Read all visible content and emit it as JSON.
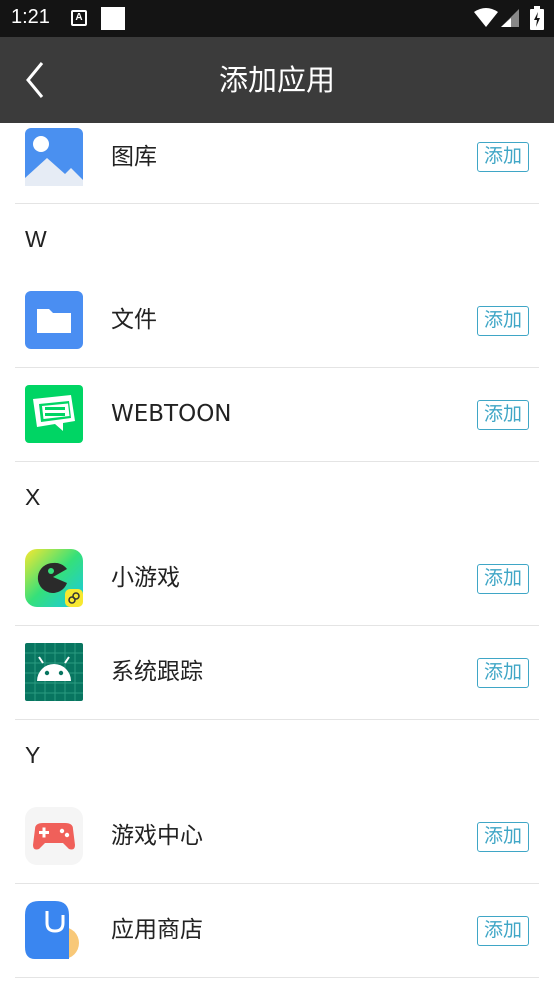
{
  "status_bar": {
    "time": "1:21",
    "notif_icon_letter": "A"
  },
  "header": {
    "title": "添加应用",
    "back_icon": "chevron-left-icon"
  },
  "colors": {
    "app_bar": "#3b3b3b",
    "status_bar": "#141414",
    "accent": "#3fa6c6"
  },
  "add_label": "添加",
  "sections": [
    {
      "letter": "",
      "apps": [
        {
          "name": "图库",
          "icon": "gallery-icon"
        }
      ]
    },
    {
      "letter": "W",
      "apps": [
        {
          "name": "文件",
          "icon": "folder-icon"
        },
        {
          "name": "WEBTOON",
          "icon": "webtoon-icon"
        }
      ]
    },
    {
      "letter": "X",
      "apps": [
        {
          "name": "小游戏",
          "icon": "mini-game-icon"
        },
        {
          "name": "系统跟踪",
          "icon": "android-icon"
        }
      ]
    },
    {
      "letter": "Y",
      "apps": [
        {
          "name": "游戏中心",
          "icon": "gamepad-icon"
        },
        {
          "name": "应用商店",
          "icon": "app-store-icon"
        }
      ]
    }
  ]
}
